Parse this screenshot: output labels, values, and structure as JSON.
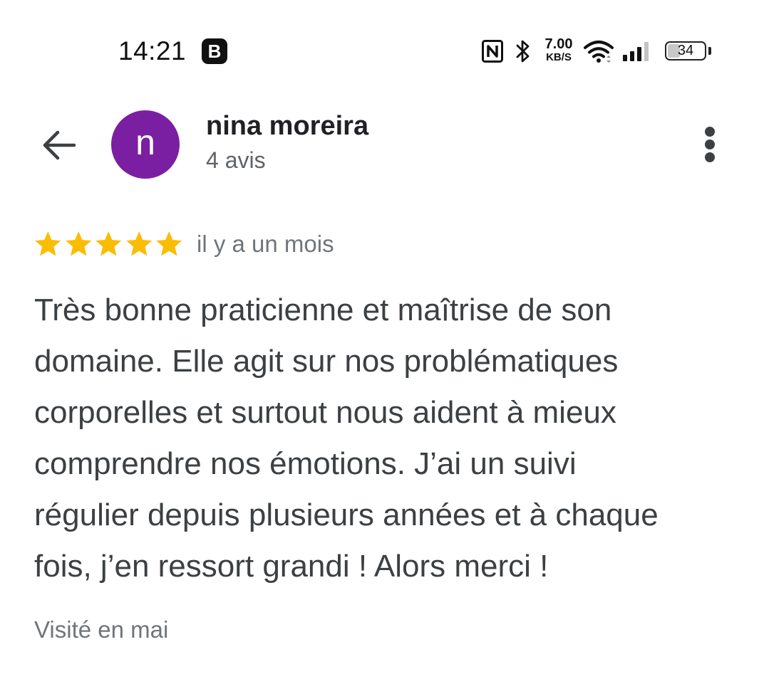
{
  "status_bar": {
    "time": "14:21",
    "app_badge": "B",
    "nfc_icon": "nfc-icon",
    "bluetooth_icon": "bluetooth-icon",
    "net_speed_value": "7.00",
    "net_speed_unit": "KB/S",
    "wifi_icon": "wifi-icon",
    "signal_icon": "cellular-signal-icon",
    "battery_percent": "34",
    "battery_level": 0.34
  },
  "header": {
    "back_icon": "arrow-back-icon",
    "avatar_letter": "n",
    "avatar_color": "#7b1fa2",
    "user_name": "nina moreira",
    "review_count": "4 avis",
    "more_icon": "more-vertical-icon"
  },
  "review": {
    "rating": 5,
    "max_rating": 5,
    "star_color": "#fbbc04",
    "date": "il y a un mois",
    "text_lines": [
      "Très bonne praticienne et maîtrise de son",
      "domaine. Elle agit sur nos problématiques",
      "corporelles et surtout nous aident à mieux",
      "comprendre nos émotions. J’ai un suivi",
      "régulier depuis plusieurs années et à chaque",
      "fois, j’en ressort grandi ! Alors merci !"
    ],
    "visit": "Visité en mai"
  }
}
